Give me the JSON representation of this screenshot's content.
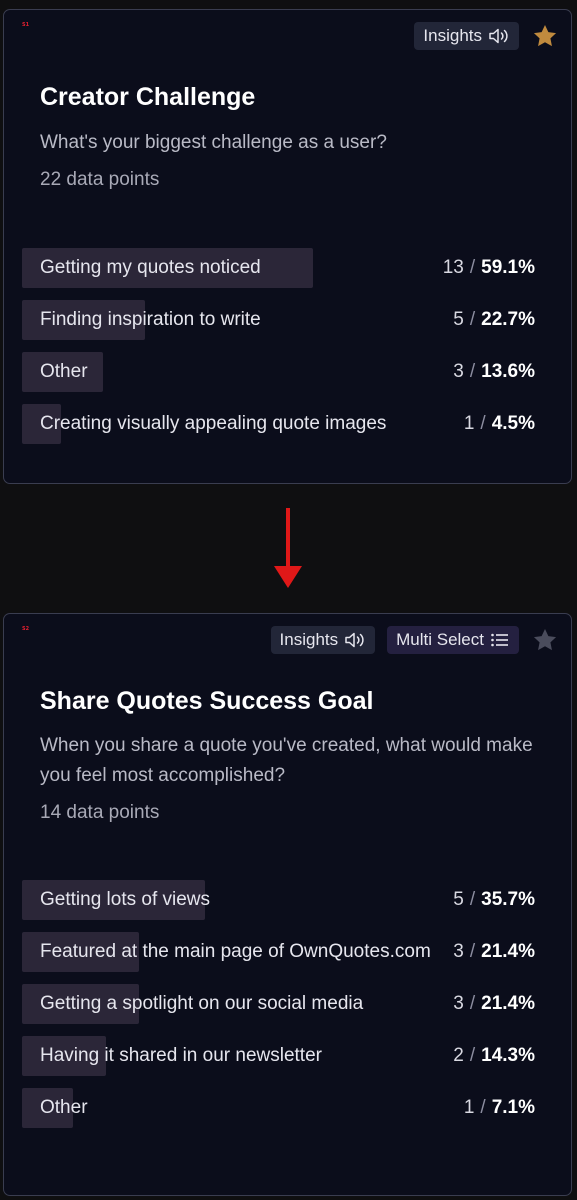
{
  "card1": {
    "tag": "S1",
    "insights_label": "Insights",
    "title": "Creator Challenge",
    "question": "What's your biggest challenge as a user?",
    "data_points": "22 data points",
    "star_color": "#c08a3e",
    "options": [
      {
        "label": "Getting my quotes noticed",
        "count": "13",
        "percent": "59.1%",
        "fraction": 0.591
      },
      {
        "label": "Finding inspiration to write",
        "count": "5",
        "percent": "22.7%",
        "fraction": 0.227
      },
      {
        "label": "Other",
        "count": "3",
        "percent": "13.6%",
        "fraction": 0.136
      },
      {
        "label": "Creating visually appealing quote images",
        "count": "1",
        "percent": "4.5%",
        "fraction": 0.045
      }
    ]
  },
  "card2": {
    "tag": "S2",
    "insights_label": "Insights",
    "multi_select_label": "Multi Select",
    "title": "Share Quotes Success Goal",
    "question": "When you share a quote you've created, what would make you feel most accomplished?",
    "data_points": "14 data points",
    "star_color": "#4a4c5c",
    "options": [
      {
        "label": "Getting lots of views",
        "count": "5",
        "percent": "35.7%",
        "fraction": 0.357
      },
      {
        "label": "Featured at the main page of OwnQuotes.com",
        "count": "3",
        "percent": "21.4%",
        "fraction": 0.214
      },
      {
        "label": "Getting a spotlight on our social media",
        "count": "3",
        "percent": "21.4%",
        "fraction": 0.214
      },
      {
        "label": "Having it shared in our newsletter",
        "count": "2",
        "percent": "14.3%",
        "fraction": 0.143
      },
      {
        "label": "Other",
        "count": "1",
        "percent": "7.1%",
        "fraction": 0.071
      }
    ]
  },
  "arrow_color": "#e01818"
}
